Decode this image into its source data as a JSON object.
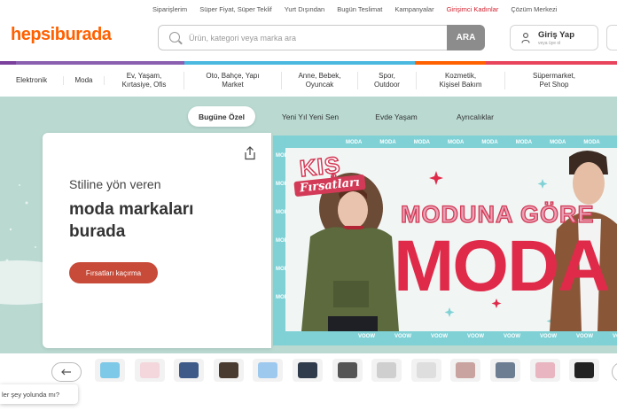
{
  "top_links": [
    {
      "label": "Siparişlerim",
      "highlight": false
    },
    {
      "label": "Süper Fiyat, Süper Teklif",
      "highlight": false
    },
    {
      "label": "Yurt Dışından",
      "highlight": false
    },
    {
      "label": "Bugün Teslimat",
      "highlight": false
    },
    {
      "label": "Kampanyalar",
      "highlight": false
    },
    {
      "label": "Girişimci Kadınlar",
      "highlight": true
    },
    {
      "label": "Çözüm Merkezi",
      "highlight": false
    }
  ],
  "logo": "hepsiburada",
  "search": {
    "placeholder": "Ürün, kategori veya marka ara",
    "button": "ARA"
  },
  "login": {
    "title": "Giriş Yap",
    "subtitle": "veya üye ol"
  },
  "colors": {
    "brand": "#ff6000",
    "accent": "#d11f2d",
    "hero_bg": "#b9d9d1",
    "cta": "#c84a38",
    "banner_frame": "#7fd1d6"
  },
  "categories": [
    "Elektronik",
    "Moda",
    "Ev, Yaşam,\nKırtasiye, Ofis",
    "Oto, Bahçe, Yapı\nMarket",
    "Anne, Bebek,\nOyuncak",
    "Spor,\nOutdoor",
    "Kozmetik,\nKişisel Bakım",
    "Süpermarket,\nPet Shop"
  ],
  "hero_tabs": [
    {
      "label": "Bugüne Özel",
      "active": true
    },
    {
      "label": "Yeni Yıl Yeni Sen",
      "active": false
    },
    {
      "label": "Evde Yaşam",
      "active": false
    },
    {
      "label": "Ayrıcalıklar",
      "active": false
    }
  ],
  "hero_card": {
    "line1": "Stiline yön veren",
    "line2": "moda markaları burada",
    "cta": "Fırsatları kaçırma",
    "share_icon": "share-icon"
  },
  "banner": {
    "kis": "KIŞ",
    "firsatlari": "Fırsatları",
    "headline_top": "MODUNA GÖRE",
    "headline_main": "MODA",
    "pattern_word": "MODA",
    "pattern_word_flipped": "VOOW"
  },
  "carousel": {
    "prev_icon": "arrow-left-icon",
    "next_icon": "arrow-right-icon"
  },
  "tooltip": "ler şey yolunda mı?"
}
